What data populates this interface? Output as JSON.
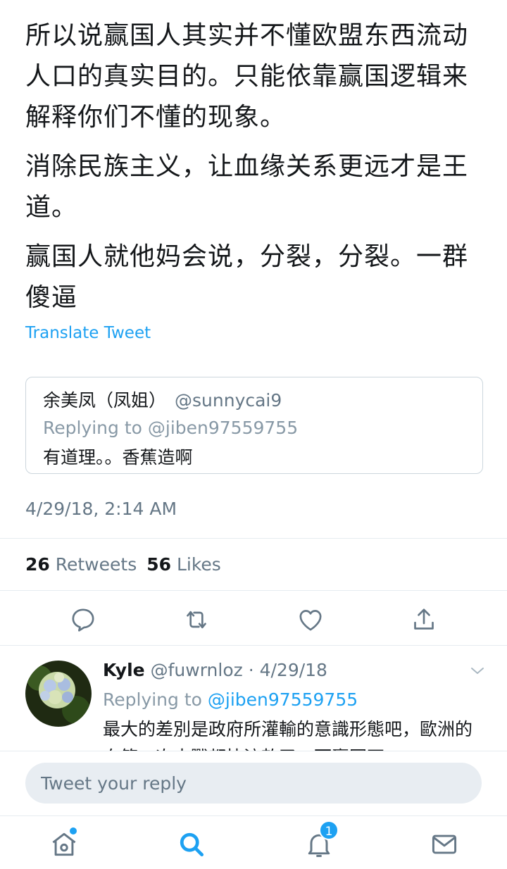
{
  "tweet": {
    "paragraphs": [
      "所以说赢国人其实并不懂欧盟东西流动人口的真实目的。只能依靠赢国逻辑来解释你们不懂的现象。",
      "消除民族主义，让血缘关系更远才是王道。",
      "赢国人就他妈会说，分裂，分裂。一群傻逼"
    ],
    "translate_label": "Translate Tweet",
    "timestamp": "4/29/18, 2:14 AM",
    "retweets_count": "26",
    "retweets_label": "Retweets",
    "likes_count": "56",
    "likes_label": "Likes"
  },
  "quoted_tweet": {
    "name": "余美凤（凤姐）",
    "handle": "@sunnycai9",
    "replying_to": "Replying to @jiben97559755",
    "text": "有道理。。香蕉造啊"
  },
  "actions": [
    {
      "icon": "reply-icon"
    },
    {
      "icon": "retweet-icon"
    },
    {
      "icon": "like-icon"
    },
    {
      "icon": "share-icon"
    }
  ],
  "reply": {
    "name": "Kyle",
    "meta": "@fuwrnloz · 4/29/18",
    "replying_prefix": "Replying to",
    "replying_mention": "@jiben97559755",
    "text": "最大的差別是政府所灌輸的意識形態吧，歐洲的血第二次大戰都快流乾了，而贏國不"
  },
  "compose": {
    "placeholder": "Tweet your reply"
  },
  "tabbar": {
    "notifications_badge": "1"
  },
  "colors": {
    "accent": "#1da1f2",
    "text": "#14171a",
    "secondary": "#657786",
    "border": "#e6ecf0"
  }
}
